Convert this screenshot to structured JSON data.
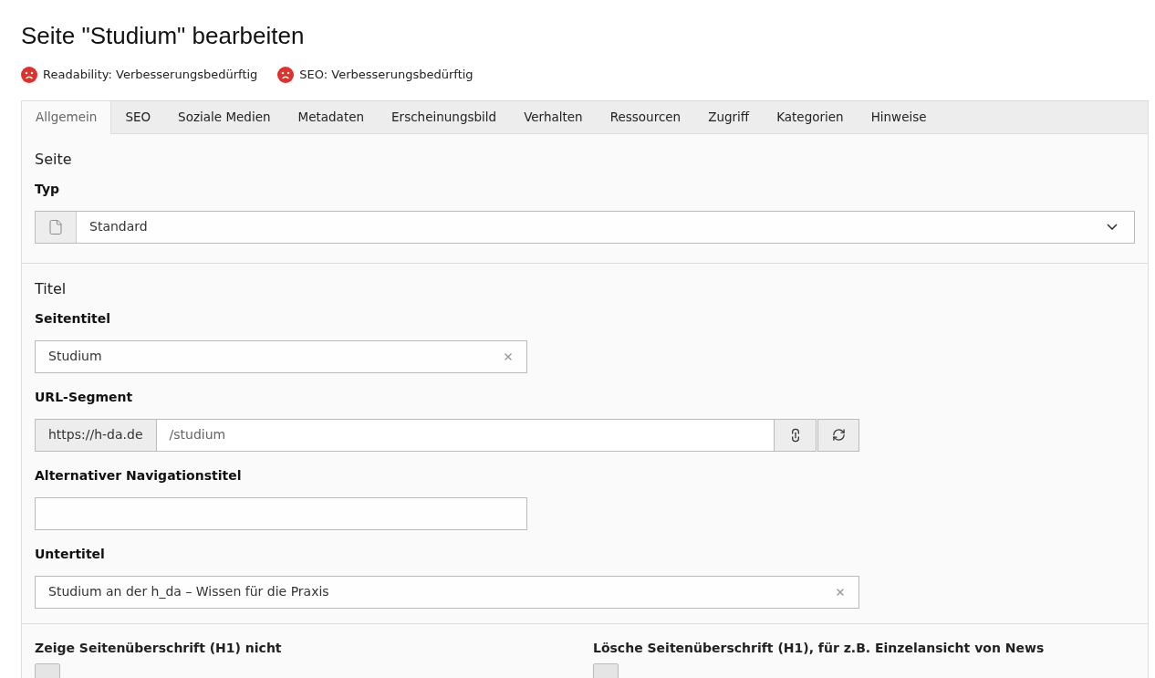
{
  "title": "Seite \"Studium\" bearbeiten",
  "ratings": [
    {
      "label": "Readability: Verbesserungsbedürftig"
    },
    {
      "label": "SEO: Verbesserungsbedürftig"
    }
  ],
  "tabs": [
    {
      "label": "Allgemein",
      "selected": true
    },
    {
      "label": "SEO",
      "selected": false
    },
    {
      "label": "Soziale Medien",
      "selected": false
    },
    {
      "label": "Metadaten",
      "selected": false
    },
    {
      "label": "Erscheinungsbild",
      "selected": false
    },
    {
      "label": "Verhalten",
      "selected": false
    },
    {
      "label": "Ressourcen",
      "selected": false
    },
    {
      "label": "Zugriff",
      "selected": false
    },
    {
      "label": "Kategorien",
      "selected": false
    },
    {
      "label": "Hinweise",
      "selected": false
    }
  ],
  "sections": [
    {
      "heading": "Seite",
      "fields": [
        {
          "kind": "select",
          "label": "Typ",
          "value": "Standard"
        }
      ]
    },
    {
      "heading": "Titel",
      "fields": [
        {
          "kind": "short-text",
          "label": "Seitentitel",
          "value": "Studium"
        },
        {
          "kind": "url",
          "label": "URL-Segment",
          "prefix": "https://h-da.de",
          "value": "/studium"
        },
        {
          "kind": "short-text",
          "label": "Alternativer Navigationstitel"
        },
        {
          "kind": "long-text",
          "label": "Untertitel",
          "value": "Studium an der h_da – Wissen für die Praxis"
        }
      ]
    },
    {
      "checkboxes": [
        {
          "label": "Zeige Seitenüberschrift (H1) nicht",
          "checked": false
        },
        {
          "label": "Lösche Seitenüberschrift (H1), für z.B. Einzelansicht von News",
          "checked": false
        }
      ]
    }
  ]
}
